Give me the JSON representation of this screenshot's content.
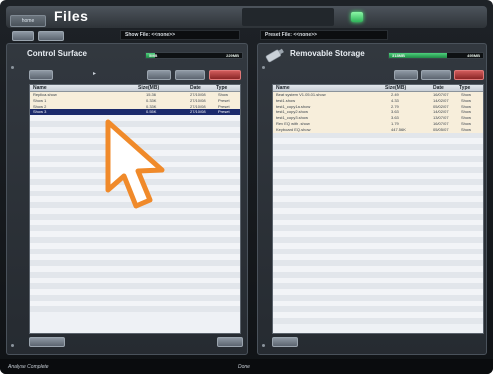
{
  "titlebar": {
    "home_tab": "home",
    "title": "Files"
  },
  "toolbar": {
    "left_buttons": [
      "",
      ""
    ],
    "show_file": "Show File: <<none>>",
    "preset_file": "Preset File: <<none>>"
  },
  "left_panel": {
    "title": "Control Surface",
    "meter": {
      "fill_fraction": 0.09,
      "left_text": "5MB",
      "right_text": "229MB"
    },
    "columns": [
      "Name",
      "Size(MB)",
      "Date",
      "Type"
    ],
    "rows": [
      {
        "name": "Replica.show",
        "size": "15.36",
        "date": "27/10/08",
        "type": "Show",
        "selected": false
      },
      {
        "name": "Show 1",
        "size": "0.33K",
        "date": "27/10/08",
        "type": "Preset",
        "selected": false
      },
      {
        "name": "Show 2",
        "size": "0.33K",
        "date": "27/10/08",
        "type": "Preset",
        "selected": false
      },
      {
        "name": "Show 3",
        "size": "0.55K",
        "date": "27/10/08",
        "type": "Preset",
        "selected": true
      }
    ],
    "empty_rows": 34
  },
  "right_panel": {
    "title": "Removable Storage",
    "meter": {
      "fill_fraction": 0.62,
      "left_text": "318MB",
      "right_text": "495MB"
    },
    "columns": [
      "Name",
      "Size(MB)",
      "Date",
      "Type"
    ],
    "rows": [
      {
        "name": "Beat system V1.05.01.show",
        "size": "2.49",
        "date": "16/07/07",
        "type": "Show"
      },
      {
        "name": "test1.show",
        "size": "4.33",
        "date": "14/02/07",
        "type": "Show"
      },
      {
        "name": "test1_copy1a.show",
        "size": "2.79",
        "date": "05/02/07",
        "type": "Show"
      },
      {
        "name": "test1_copy2.show",
        "size": "3.63",
        "date": "14/02/07",
        "type": "Show"
      },
      {
        "name": "test1_copy3.show",
        "size": "3.63",
        "date": "13/07/07",
        "type": "Show"
      },
      {
        "name": "Rev EQ with .show",
        "size": "1.79",
        "date": "16/07/07",
        "type": "Show"
      },
      {
        "name": "Keyboard EQ.show",
        "size": "447.56K",
        "date": "05/05/07",
        "type": "Show"
      }
    ],
    "empty_rows": 33
  },
  "status": {
    "left": "Analyse Complete",
    "center": "Done"
  },
  "colors": {
    "accent_green": "#2fb359",
    "selection_blue": "#1b2a6b",
    "red_button": "#b23a3a"
  }
}
